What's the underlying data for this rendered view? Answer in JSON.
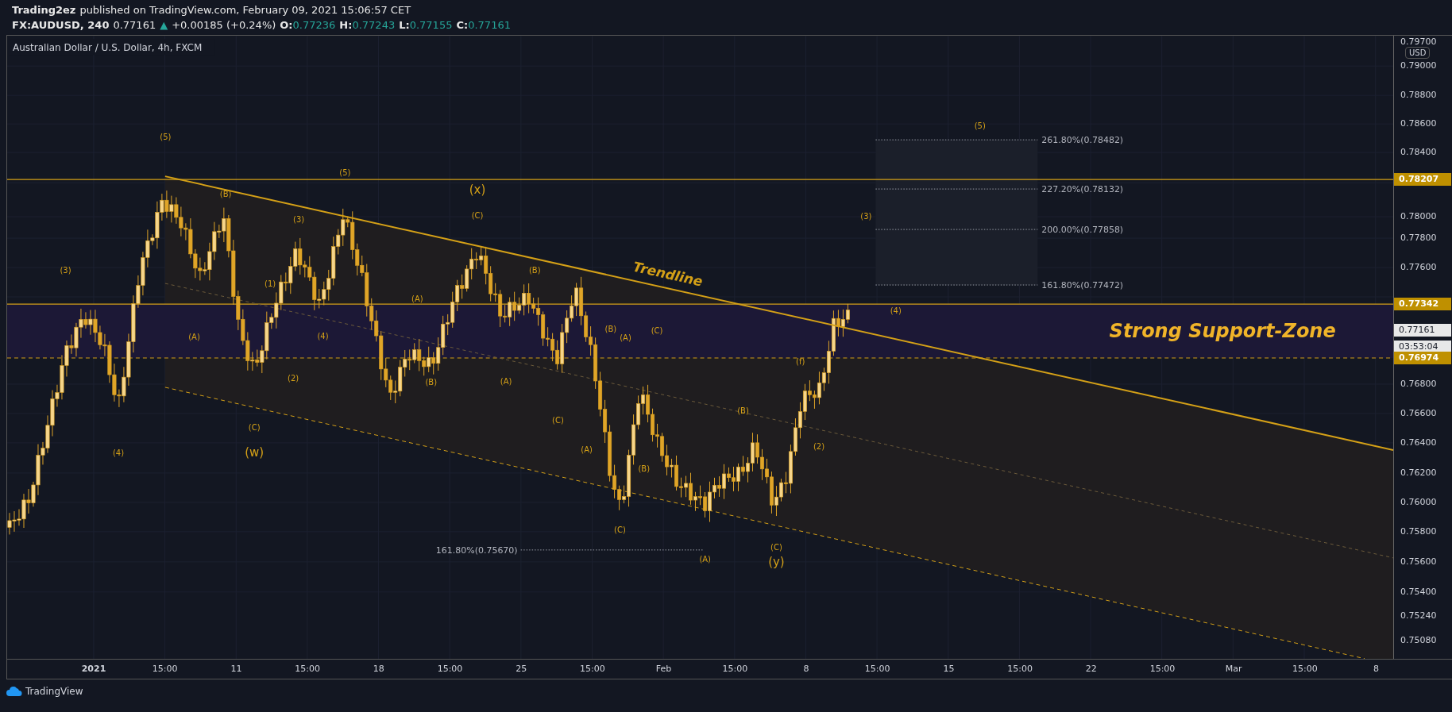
{
  "header": {
    "author": "Trading2ez",
    "published": "published on TradingView.com, February 09, 2021 15:06:57 CET"
  },
  "symbol": {
    "ticker": "FX:AUDUSD, 240",
    "last": "0.77161",
    "arrow": "▲",
    "change": "+0.00185 (+0.24%)",
    "ohlc": [
      {
        "key": "O:",
        "value": "0.77236"
      },
      {
        "key": "H:",
        "value": "0.77243"
      },
      {
        "key": "L:",
        "value": "0.77155"
      },
      {
        "key": "C:",
        "value": "0.77161"
      }
    ]
  },
  "chart": {
    "title": "Australian Dollar / U.S. Dollar, 4h, FXCM",
    "trendline_label": "Trendline",
    "zone_label": "Strong Support-Zone",
    "fib_levels": [
      "261.80%(0.78482)",
      "227.20%(0.78132)",
      "200.00%(0.77858)",
      "161.80%(0.77472)",
      "161.80%(0.75670)"
    ],
    "wave_labels": [
      {
        "text": "(3)",
        "large": false
      },
      {
        "text": "(4)",
        "large": false
      },
      {
        "text": "(5)",
        "large": false
      },
      {
        "text": "(A)",
        "large": false
      },
      {
        "text": "(B)",
        "large": false
      },
      {
        "text": "(C)",
        "large": false
      },
      {
        "text": "(w)",
        "large": true
      },
      {
        "text": "(1)",
        "large": false
      },
      {
        "text": "(2)",
        "large": false
      },
      {
        "text": "(3)",
        "large": false
      },
      {
        "text": "(4)",
        "large": false
      },
      {
        "text": "(5)",
        "large": false
      },
      {
        "text": "(A)",
        "large": false
      },
      {
        "text": "(B)",
        "large": false
      },
      {
        "text": "(x)",
        "large": true
      },
      {
        "text": "(C)",
        "large": false
      },
      {
        "text": "(A)",
        "large": false
      },
      {
        "text": "(B)",
        "large": false
      },
      {
        "text": "(C)",
        "large": false
      },
      {
        "text": "(A)",
        "large": false
      },
      {
        "text": "(B)",
        "large": false
      },
      {
        "text": "(C)",
        "large": false
      },
      {
        "text": "(A)",
        "large": false
      },
      {
        "text": "(B)",
        "large": false
      },
      {
        "text": "(C)",
        "large": false
      },
      {
        "text": "(A)",
        "large": false
      },
      {
        "text": "(B)",
        "large": false
      },
      {
        "text": "(C)",
        "large": false
      },
      {
        "text": "(y)",
        "large": true
      },
      {
        "text": "(f)",
        "large": false
      },
      {
        "text": "(2)",
        "large": false
      },
      {
        "text": "(3)",
        "large": false
      },
      {
        "text": "(4)",
        "large": false
      },
      {
        "text": "(5)",
        "large": false
      }
    ],
    "currency": "USD",
    "price_axis": [
      "0.79700",
      "0.79000",
      "0.78800",
      "0.78600",
      "0.78400",
      "0.78000",
      "0.77800",
      "0.77600",
      "0.76800",
      "0.76600",
      "0.76400",
      "0.76200",
      "0.76000",
      "0.75800",
      "0.75600",
      "0.75400",
      "0.75240",
      "0.75080"
    ],
    "price_tags": [
      {
        "text": "0.78207",
        "kind": "level"
      },
      {
        "text": "0.77342",
        "kind": "level"
      },
      {
        "text": "0.77161",
        "kind": "last"
      },
      {
        "text": "03:53:04",
        "kind": "countdown"
      },
      {
        "text": "0.76974",
        "kind": "level"
      }
    ],
    "time_axis": [
      "2021",
      "15:00",
      "11",
      "15:00",
      "18",
      "15:00",
      "25",
      "15:00",
      "Feb",
      "15:00",
      "8",
      "15:00",
      "15",
      "15:00",
      "22",
      "15:00",
      "Mar",
      "15:00",
      "8"
    ]
  },
  "footer": {
    "brand": "TradingView"
  }
}
